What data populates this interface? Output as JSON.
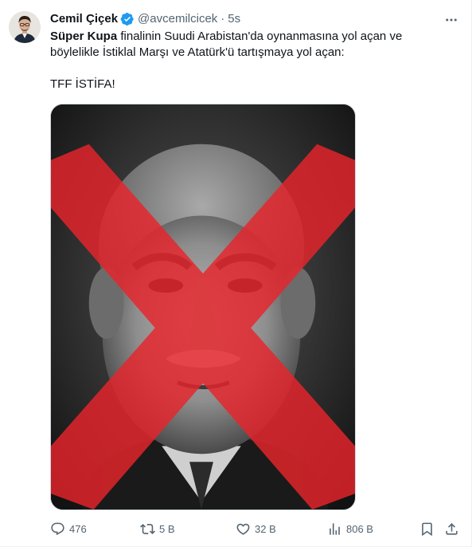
{
  "tweet": {
    "display_name": "Cemil Çiçek",
    "handle": "@avcemilcicek",
    "separator": "·",
    "time": "5s",
    "text_bold": "Süper Kupa",
    "text_line1_rest": " finalinin Suudi Arabistan'da oynanmasına yol açan ve",
    "text_line2": "böylelikle İstiklal Marşı ve Atatürk'ü tartışmaya yol açan:",
    "text_line3": "TFF İSTİFA!",
    "media": {
      "description_icon": "crossed-out-portrait",
      "cross_color": "#e8252b"
    }
  },
  "actions": {
    "reply": {
      "icon": "reply-icon",
      "count": "476"
    },
    "retweet": {
      "icon": "retweet-icon",
      "count": "5 B"
    },
    "like": {
      "icon": "heart-icon",
      "count": "32 B"
    },
    "views": {
      "icon": "views-icon",
      "count": "806 B"
    },
    "bookmark": {
      "icon": "bookmark-icon"
    },
    "share": {
      "icon": "share-icon"
    }
  },
  "colors": {
    "text_primary": "#0f1419",
    "text_secondary": "#536471",
    "verified": "#1d9bf0"
  }
}
